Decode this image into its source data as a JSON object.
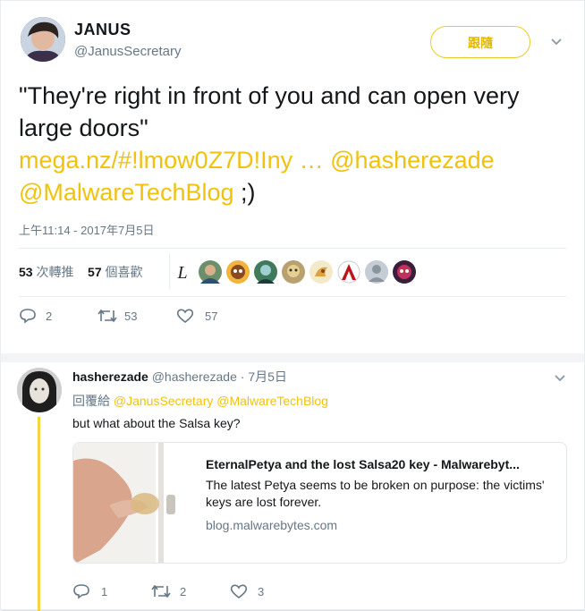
{
  "tweet": {
    "author_name": "JANUS",
    "author_handle": "@JanusSecretary",
    "follow_label": "跟隨",
    "text_main": "\"They're right in front of you and can open very large doors\"",
    "link_url": "mega.nz/#!lmow0Z7D!Iny  …",
    "mention_1": "@hasherezade",
    "mention_2": "@MalwareTechBlog",
    "text_end": ";)",
    "timestamp": "上午11:14 - 2017年7月5日",
    "retweets_count": "53",
    "retweets_label": "次轉推",
    "likes_count": "57",
    "likes_label": "個喜歡",
    "actions": {
      "replies": "2",
      "retweets": "53",
      "likes": "57"
    }
  },
  "reply": {
    "author_name": "hasherezade",
    "author_handle": "@hasherezade",
    "date": "· 7月5日",
    "reply_prefix": "回覆給",
    "reply_mentions": "@JanusSecretary @MalwareTechBlog",
    "text": "but what about the Salsa key?",
    "card": {
      "title": "EternalPetya and the lost Salsa20 key - Malwarebyt...",
      "description": "The latest Petya seems to be broken on purpose: the victims' keys are lost forever.",
      "domain": "blog.malwarebytes.com"
    },
    "actions": {
      "replies": "1",
      "retweets": "2",
      "likes": "3"
    }
  },
  "icons": {
    "reply": "reply-icon",
    "retweet": "retweet-icon",
    "like": "heart-icon",
    "more": "chevron-down-icon"
  },
  "colors": {
    "accent": "#f0c20f",
    "secondary_text": "#657786",
    "divider": "#e6ecf0"
  }
}
